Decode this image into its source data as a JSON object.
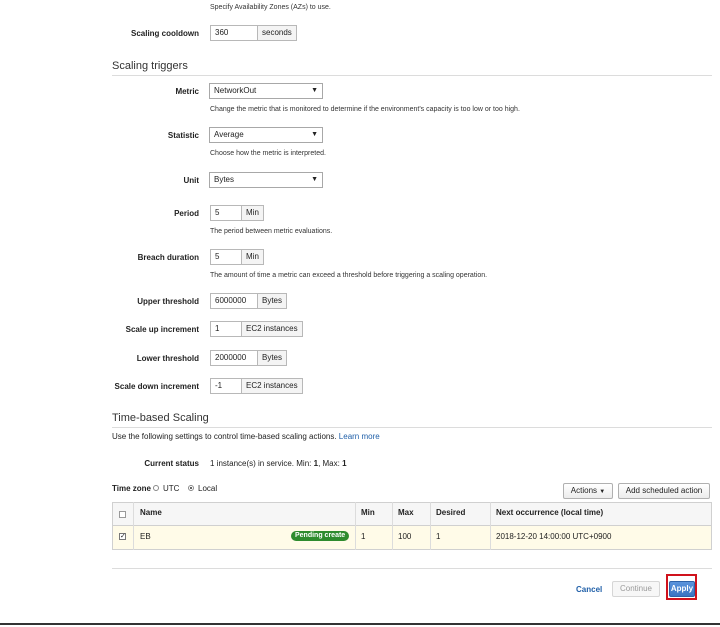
{
  "az_help": "Specify Availability Zones (AZs) to use.",
  "cooldown": {
    "label": "Scaling cooldown",
    "value": "360",
    "unit": "seconds"
  },
  "triggers": {
    "title": "Scaling triggers",
    "metric": {
      "label": "Metric",
      "value": "NetworkOut",
      "help": "Change the metric that is monitored to determine if the environment's capacity is too low or too high."
    },
    "statistic": {
      "label": "Statistic",
      "value": "Average",
      "help": "Choose how the metric is interpreted."
    },
    "unit": {
      "label": "Unit",
      "value": "Bytes"
    },
    "period": {
      "label": "Period",
      "value": "5",
      "unit": "Min",
      "help": "The period between metric evaluations."
    },
    "breach": {
      "label": "Breach duration",
      "value": "5",
      "unit": "Min",
      "help": "The amount of time a metric can exceed a threshold before triggering a scaling operation."
    },
    "upper": {
      "label": "Upper threshold",
      "value": "6000000",
      "unit": "Bytes"
    },
    "scale_up": {
      "label": "Scale up increment",
      "value": "1",
      "unit": "EC2 instances"
    },
    "lower": {
      "label": "Lower threshold",
      "value": "2000000",
      "unit": "Bytes"
    },
    "scale_down": {
      "label": "Scale down increment",
      "value": "-1",
      "unit": "EC2 instances"
    }
  },
  "time_scaling": {
    "title": "Time-based Scaling",
    "desc": "Use the following settings to control time-based scaling actions.",
    "learn_more": "Learn more",
    "status_label": "Current status",
    "status_prefix": "1 instance(s) in service. Min:",
    "status_min": "1",
    "status_mid": ", Max:",
    "status_max": "1",
    "timezone_label": "Time zone",
    "tz_utc": "UTC",
    "tz_local": "Local",
    "actions_button": "Actions",
    "add_button": "Add scheduled action",
    "columns": {
      "name": "Name",
      "min": "Min",
      "max": "Max",
      "desired": "Desired",
      "next": "Next occurrence (local time)"
    },
    "row": {
      "name": "EB",
      "badge": "Pending create",
      "min": "1",
      "max": "100",
      "desired": "1",
      "next": "2018-12-20 14:00:00 UTC+0900"
    }
  },
  "footer": {
    "cancel": "Cancel",
    "continue": "Continue",
    "apply": "Apply"
  }
}
